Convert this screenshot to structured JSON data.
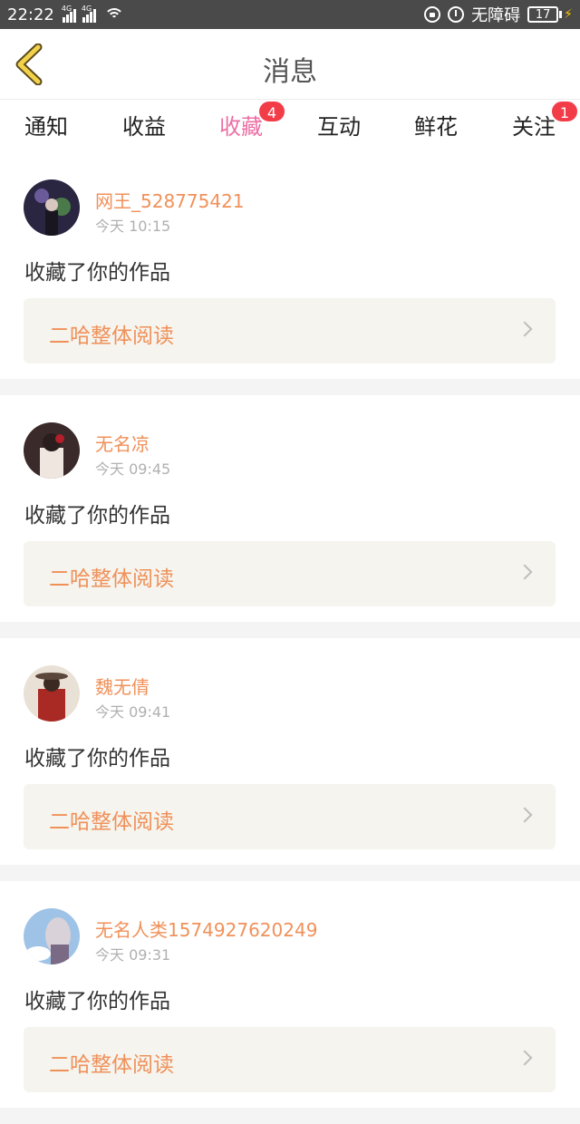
{
  "status_bar": {
    "time": "22:22",
    "network1": "4G",
    "network2": "4G",
    "mode_label": "无障碍",
    "battery": "17"
  },
  "header": {
    "title": "消息",
    "back_icon": "chevron-left-icon"
  },
  "tabs": [
    {
      "label": "通知"
    },
    {
      "label": "收益"
    },
    {
      "label": "收藏",
      "badge": "4",
      "active": true
    },
    {
      "label": "互动"
    },
    {
      "label": "鲜花"
    },
    {
      "label": "关注",
      "badge": "1"
    }
  ],
  "colors": {
    "accent": "#ec6fa4",
    "username": "#f0915a",
    "badge": "#f23d49"
  },
  "messages": [
    {
      "username": "网王_528775421",
      "time": "今天 10:15",
      "action": "收藏了你的作品",
      "work": "二哈整体阅读"
    },
    {
      "username": "无名凉",
      "time": "今天 09:45",
      "action": "收藏了你的作品",
      "work": "二哈整体阅读"
    },
    {
      "username": "魏无倩",
      "time": "今天 09:41",
      "action": "收藏了你的作品",
      "work": "二哈整体阅读"
    },
    {
      "username": "无名人类1574927620249",
      "time": "今天 09:31",
      "action": "收藏了你的作品",
      "work": "二哈整体阅读"
    }
  ]
}
